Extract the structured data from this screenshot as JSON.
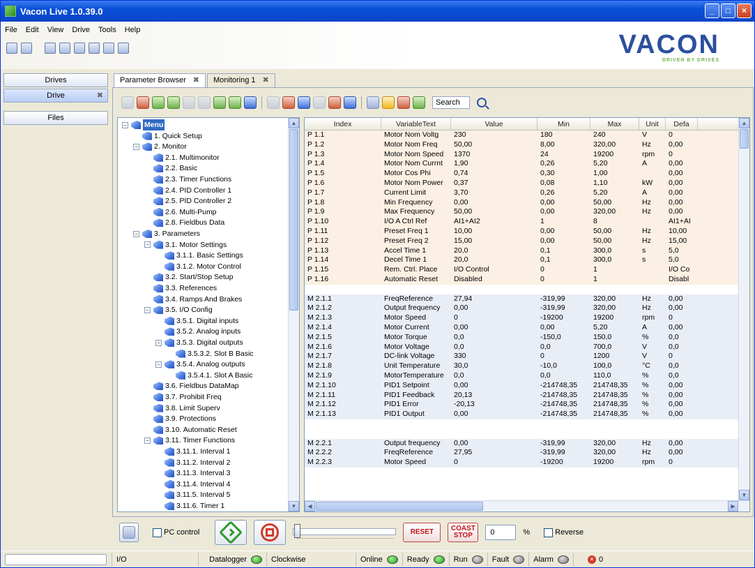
{
  "window": {
    "title": "Vacon Live 1.0.39.0"
  },
  "menu": [
    "File",
    "Edit",
    "View",
    "Drive",
    "Tools",
    "Help"
  ],
  "logo": {
    "text": "VACON",
    "tagline": "DRIVEN BY DRIVES"
  },
  "left": {
    "drives_label": "Drives",
    "drive_label": "Drive",
    "files_label": "Files",
    "close_glyph": "✖"
  },
  "tabs": [
    {
      "label": "Parameter Browser",
      "active": true
    },
    {
      "label": "Monitoring 1",
      "active": false
    }
  ],
  "search": {
    "label": "Search"
  },
  "tree": [
    {
      "label": "Menu",
      "level": 0,
      "expander": "−",
      "root": true
    },
    {
      "label": "1. Quick Setup",
      "level": 1,
      "expander": ""
    },
    {
      "label": "2. Monitor",
      "level": 1,
      "expander": "−"
    },
    {
      "label": "2.1. Multimonitor",
      "level": 2,
      "expander": ""
    },
    {
      "label": "2.2. Basic",
      "level": 2,
      "expander": ""
    },
    {
      "label": "2.3. Timer Functions",
      "level": 2,
      "expander": ""
    },
    {
      "label": "2.4. PID Controller 1",
      "level": 2,
      "expander": ""
    },
    {
      "label": "2.5. PID Controller 2",
      "level": 2,
      "expander": ""
    },
    {
      "label": "2.6. Multi-Pump",
      "level": 2,
      "expander": ""
    },
    {
      "label": "2.8. Fieldbus Data",
      "level": 2,
      "expander": ""
    },
    {
      "label": "3. Parameters",
      "level": 1,
      "expander": "−"
    },
    {
      "label": "3.1. Motor Settings",
      "level": 2,
      "expander": "−"
    },
    {
      "label": "3.1.1. Basic Settings",
      "level": 3,
      "expander": ""
    },
    {
      "label": "3.1.2. Motor Control",
      "level": 3,
      "expander": ""
    },
    {
      "label": "3.2. Start/Stop Setup",
      "level": 2,
      "expander": ""
    },
    {
      "label": "3.3. References",
      "level": 2,
      "expander": ""
    },
    {
      "label": "3.4. Ramps And Brakes",
      "level": 2,
      "expander": ""
    },
    {
      "label": "3.5. I/O Config",
      "level": 2,
      "expander": "−"
    },
    {
      "label": "3.5.1. Digital inputs",
      "level": 3,
      "expander": ""
    },
    {
      "label": "3.5.2. Analog inputs",
      "level": 3,
      "expander": ""
    },
    {
      "label": "3.5.3. Digital outputs",
      "level": 3,
      "expander": "−"
    },
    {
      "label": "3.5.3.2. Slot B Basic",
      "level": 4,
      "expander": ""
    },
    {
      "label": "3.5.4. Analog outputs",
      "level": 3,
      "expander": "−"
    },
    {
      "label": "3.5.4.1. Slot A Basic",
      "level": 4,
      "expander": ""
    },
    {
      "label": "3.6. Fieldbus DataMap",
      "level": 2,
      "expander": ""
    },
    {
      "label": "3.7. Prohibit Freq",
      "level": 2,
      "expander": ""
    },
    {
      "label": "3.8. Limit Superv",
      "level": 2,
      "expander": ""
    },
    {
      "label": "3.9. Protections",
      "level": 2,
      "expander": ""
    },
    {
      "label": "3.10. Automatic Reset",
      "level": 2,
      "expander": ""
    },
    {
      "label": "3.11. Timer Functions",
      "level": 2,
      "expander": "−"
    },
    {
      "label": "3.11.1. Interval 1",
      "level": 3,
      "expander": ""
    },
    {
      "label": "3.11.2. Interval 2",
      "level": 3,
      "expander": ""
    },
    {
      "label": "3.11.3. Interval 3",
      "level": 3,
      "expander": ""
    },
    {
      "label": "3.11.4. Interval 4",
      "level": 3,
      "expander": ""
    },
    {
      "label": "3.11.5. Interval 5",
      "level": 3,
      "expander": ""
    },
    {
      "label": "3.11.6. Timer 1",
      "level": 3,
      "expander": ""
    }
  ],
  "grid": {
    "columns": [
      "Index",
      "VariableText",
      "Value",
      "Min",
      "Max",
      "Unit",
      "Defa"
    ],
    "rows": [
      {
        "t": "p",
        "c": [
          "P 1.1",
          "Motor Nom Voltg",
          "230",
          "180",
          "240",
          "V",
          "0"
        ]
      },
      {
        "t": "p",
        "c": [
          "P 1.2",
          "Motor Nom Freq",
          "50,00",
          "8,00",
          "320,00",
          "Hz",
          "0,00"
        ]
      },
      {
        "t": "p",
        "c": [
          "P 1.3",
          "Motor Nom Speed",
          "1370",
          "24",
          "19200",
          "rpm",
          "0"
        ]
      },
      {
        "t": "p",
        "c": [
          "P 1.4",
          "Motor Nom Currnt",
          "1,90",
          "0,26",
          "5,20",
          "A",
          "0,00"
        ]
      },
      {
        "t": "p",
        "c": [
          "P 1.5",
          "Motor Cos Phi",
          "0,74",
          "0,30",
          "1,00",
          "",
          "0,00"
        ]
      },
      {
        "t": "p",
        "c": [
          "P 1.6",
          "Motor Nom Power",
          "0,37",
          "0,08",
          "1,10",
          "kW",
          "0,00"
        ]
      },
      {
        "t": "p",
        "c": [
          "P 1.7",
          "Current Limit",
          "3,70",
          "0,26",
          "5,20",
          "A",
          "0,00"
        ]
      },
      {
        "t": "p",
        "c": [
          "P 1.8",
          "Min Frequency",
          "0,00",
          "0,00",
          "50,00",
          "Hz",
          "0,00"
        ]
      },
      {
        "t": "p",
        "c": [
          "P 1.9",
          "Max Frequency",
          "50,00",
          "0,00",
          "320,00",
          "Hz",
          "0,00"
        ]
      },
      {
        "t": "p",
        "c": [
          "P 1.10",
          "I/O A Ctrl Ref",
          "AI1+AI2",
          "1",
          "8",
          "",
          "AI1+AI"
        ]
      },
      {
        "t": "p",
        "c": [
          "P 1.11",
          "Preset Freq 1",
          "10,00",
          "0,00",
          "50,00",
          "Hz",
          "10,00"
        ]
      },
      {
        "t": "p",
        "c": [
          "P 1.12",
          "Preset Freq 2",
          "15,00",
          "0,00",
          "50,00",
          "Hz",
          "15,00"
        ]
      },
      {
        "t": "p",
        "c": [
          "P 1.13",
          "Accel Time 1",
          "20,0",
          "0,1",
          "300,0",
          "s",
          "5,0"
        ]
      },
      {
        "t": "p",
        "c": [
          "P 1.14",
          "Decel Time 1",
          "20,0",
          "0,1",
          "300,0",
          "s",
          "5,0"
        ]
      },
      {
        "t": "p",
        "c": [
          "P 1.15",
          "Rem. Ctrl. Place",
          "I/O Control",
          "0",
          "1",
          "",
          "I/O Co"
        ]
      },
      {
        "t": "p",
        "c": [
          "P 1.16",
          "Automatic Reset",
          "Disabled",
          "0",
          "1",
          "",
          "Disabl"
        ]
      },
      {
        "t": "blank",
        "c": [
          "",
          "",
          "",
          "",
          "",
          "",
          ""
        ]
      },
      {
        "t": "m",
        "c": [
          "M 2.1.1",
          "FreqReference",
          "27,94",
          "-319,99",
          "320,00",
          "Hz",
          "0,00"
        ]
      },
      {
        "t": "m",
        "c": [
          "M 2.1.2",
          "Output frequency",
          "0,00",
          "-319,99",
          "320,00",
          "Hz",
          "0,00"
        ]
      },
      {
        "t": "m",
        "c": [
          "M 2.1.3",
          "Motor Speed",
          "0",
          "-19200",
          "19200",
          "rpm",
          "0"
        ]
      },
      {
        "t": "m",
        "c": [
          "M 2.1.4",
          "Motor Current",
          "0,00",
          "0,00",
          "5,20",
          "A",
          "0,00"
        ]
      },
      {
        "t": "m",
        "c": [
          "M 2.1.5",
          "Motor Torque",
          "0,0",
          "-150,0",
          "150,0",
          "%",
          "0,0"
        ]
      },
      {
        "t": "m",
        "c": [
          "M 2.1.6",
          "Motor Voltage",
          "0,0",
          "0,0",
          "700,0",
          "V",
          "0,0"
        ]
      },
      {
        "t": "m",
        "c": [
          "M 2.1.7",
          "DC-link Voltage",
          "330",
          "0",
          "1200",
          "V",
          "0"
        ]
      },
      {
        "t": "m",
        "c": [
          "M 2.1.8",
          "Unit Temperature",
          "30,0",
          "-10,0",
          "100,0",
          "°C",
          "0,0"
        ]
      },
      {
        "t": "m",
        "c": [
          "M 2.1.9",
          "MotorTemperature",
          "0,0",
          "0,0",
          "110,0",
          "%",
          "0,0"
        ]
      },
      {
        "t": "m",
        "c": [
          "M 2.1.10",
          "PID1 Setpoint",
          "0,00",
          "-214748,35",
          "214748,35",
          "%",
          "0,00"
        ]
      },
      {
        "t": "m",
        "c": [
          "M 2.1.11",
          "PID1 Feedback",
          "20,13",
          "-214748,35",
          "214748,35",
          "%",
          "0,00"
        ]
      },
      {
        "t": "m",
        "c": [
          "M 2.1.12",
          "PID1 Error",
          "-20,13",
          "-214748,35",
          "214748,35",
          "%",
          "0,00"
        ]
      },
      {
        "t": "m",
        "c": [
          "M 2.1.13",
          "PID1 Output",
          "0,00",
          "-214748,35",
          "214748,35",
          "%",
          "0,00"
        ]
      },
      {
        "t": "blank",
        "c": [
          "",
          "",
          "",
          "",
          "",
          "",
          ""
        ]
      },
      {
        "t": "blank",
        "c": [
          "",
          "",
          "",
          "",
          "",
          "",
          ""
        ]
      },
      {
        "t": "m",
        "c": [
          "M 2.2.1",
          "Output frequency",
          "0,00",
          "-319,99",
          "320,00",
          "Hz",
          "0,00"
        ]
      },
      {
        "t": "m",
        "c": [
          "M 2.2.2",
          "FreqReference",
          "27,95",
          "-319,99",
          "320,00",
          "Hz",
          "0,00"
        ]
      },
      {
        "t": "m",
        "c": [
          "M 2.2.3",
          "Motor Speed",
          "0",
          "-19200",
          "19200",
          "rpm",
          "0"
        ]
      }
    ]
  },
  "controls": {
    "pc_control": "PC control",
    "reset": "RESET",
    "coast": "COAST",
    "stop": "STOP",
    "speed_value": "0",
    "percent": "%",
    "reverse": "Reverse"
  },
  "status": {
    "io": "I/O",
    "datalogger": "Datalogger",
    "clockwise": "Clockwise",
    "online": "Online",
    "ready": "Ready",
    "run": "Run",
    "fault": "Fault",
    "alarm": "Alarm",
    "errors": "0"
  }
}
